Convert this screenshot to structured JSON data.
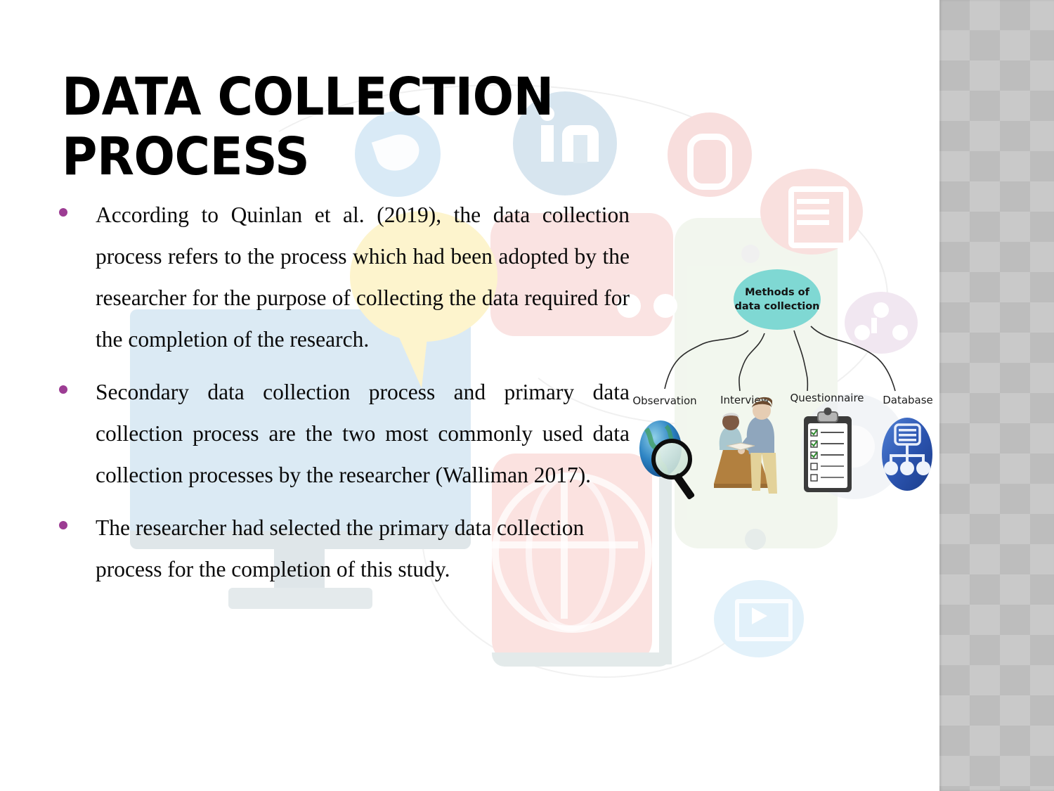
{
  "slide": {
    "title": "DATA COLLECTION PROCESS",
    "bullets": [
      "According to Quinlan et al. (2019), the data collection process refers to the process which had been adopted by the researcher for the purpose of collecting the data required for the completion of the research.",
      "Secondary data collection process and primary data collection process are the two most commonly used data collection processes by the researcher (Walliman 2017).",
      "The researcher had selected the primary data collection process for the completion of this study."
    ],
    "bullet_color": "#9C3C93",
    "title_color": "#000000",
    "body_color": "#0a0a0a",
    "background_color": "#ffffff"
  },
  "diagram": {
    "center_label_line1": "Methods of",
    "center_label_line2": "data collection",
    "center_fill": "#7FD8D3",
    "branches": [
      {
        "label": "Observation",
        "icon": "globe-magnifier-icon"
      },
      {
        "label": "Interview",
        "icon": "people-at-table-icon"
      },
      {
        "label": "Questionnaire",
        "icon": "clipboard-checklist-icon"
      },
      {
        "label": "Database",
        "icon": "database-oval-icon"
      }
    ]
  },
  "background": {
    "side_strip_pattern": "argyle-diamond",
    "side_strip_color": "#bdbdbd",
    "watermark_icons": [
      "twitter-icon",
      "linkedin-icon",
      "googleplus-icon",
      "note-pencil-icon",
      "network-share-icon",
      "video-play-icon",
      "globe-grid-icon",
      "monitor-icon",
      "speech-bubble-icon",
      "tablet-icon",
      "gear-icon"
    ]
  }
}
